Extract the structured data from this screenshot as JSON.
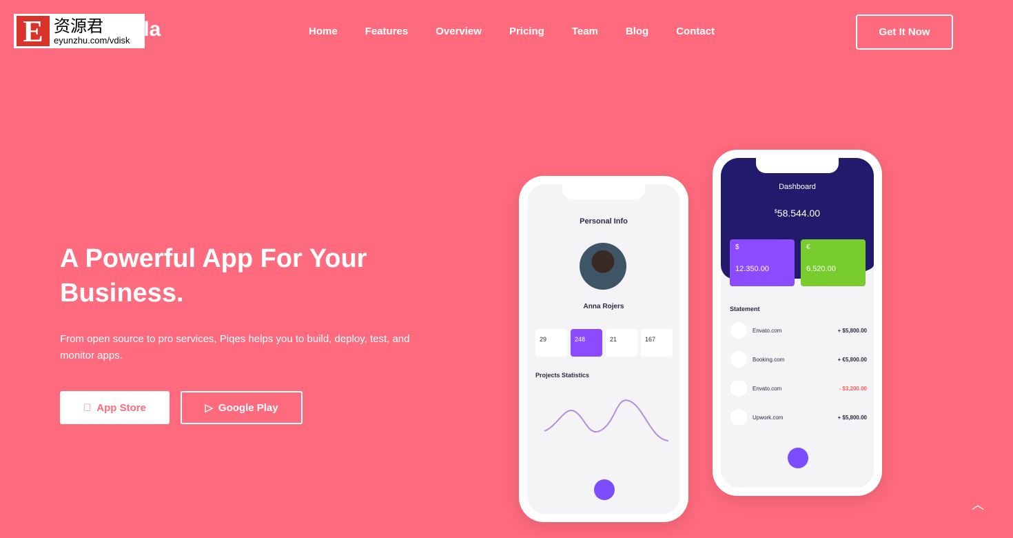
{
  "watermark": {
    "letter": "E",
    "chinese": "资源君",
    "url": "eyunzhu.com/vdisk"
  },
  "logo": {
    "visible_text": "ila"
  },
  "nav": [
    "Home",
    "Features",
    "Overview",
    "Pricing",
    "Team",
    "Blog",
    "Contact"
  ],
  "cta": "Get It Now",
  "hero": {
    "title": "A Powerful App For Your Business.",
    "description": "From open source to pro services, Piqes helps you to build, deploy, test, and monitor apps.",
    "app_store": "App Store",
    "google_play": "Google Play"
  },
  "phone1": {
    "title": "Personal Info",
    "name": "Anna Rojers",
    "stats": [
      {
        "value": "29"
      },
      {
        "value": "248"
      },
      {
        "value": "21"
      },
      {
        "value": "167"
      }
    ],
    "chart_title": "Projects Statistics"
  },
  "phone2": {
    "title": "Dashboard",
    "balance": "58.544.00",
    "currency": "$",
    "cards": [
      {
        "symbol": "$",
        "amount": "12.350.00",
        "color": "#8c4bff"
      },
      {
        "symbol": "€",
        "amount": "6.520.00",
        "color": "#79cc2e"
      }
    ],
    "statement_title": "Statement",
    "transactions": [
      {
        "name": "Envato.com",
        "amount": "+ $5,800.00"
      },
      {
        "name": "Booking.com",
        "amount": "+ €5,800.00"
      },
      {
        "name": "Envato.com",
        "amount": "- $3,200.00",
        "negative": true
      },
      {
        "name": "Upwork.com",
        "amount": "+ $5,800.00"
      }
    ]
  },
  "colors": {
    "background": "#ff6b7e",
    "accent": "#7b4dff",
    "dark": "#221a6a"
  }
}
